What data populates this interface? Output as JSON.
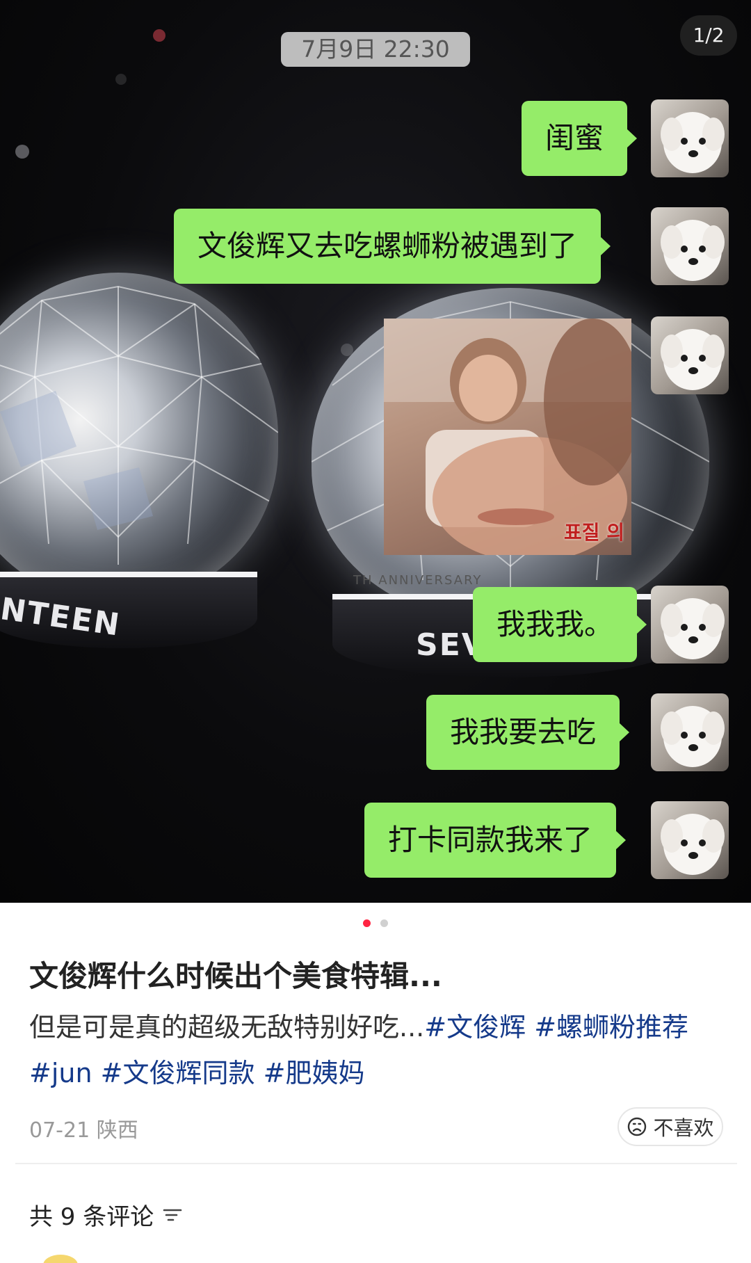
{
  "chat": {
    "timestamp": "7月9日 22:30",
    "counter": "1/2",
    "messages": [
      {
        "text": "闺蜜"
      },
      {
        "text": "文俊辉又去吃螺蛳粉被遇到了"
      },
      {
        "text": "我我我。"
      },
      {
        "text": "我我要去吃"
      },
      {
        "text": "打卡同款我来了"
      }
    ],
    "sticker_caption": "표질 의",
    "bubble_color": "#95ec69",
    "lightstick_text_left": "NTEEN",
    "lightstick_text_right": "SEVENTEEN",
    "lightstick_ring_text": "TH ANNIVERSARY"
  },
  "post": {
    "title": "文俊辉什么时候出个美食特辑...",
    "desc_text": "但是可是真的超级无敌特别好吃...",
    "tags": [
      "#文俊辉",
      "#螺蛳粉推荐",
      "#jun",
      "#文俊辉同款",
      "#肥姨妈"
    ],
    "date": "07-21",
    "location": "陕西",
    "dislike_label": "不喜欢",
    "comments_label": "共 9 条评论",
    "tag_color": "#153a8a",
    "active_dot_color": "#ff2442",
    "inactive_dot_color": "#d0d0d0"
  }
}
